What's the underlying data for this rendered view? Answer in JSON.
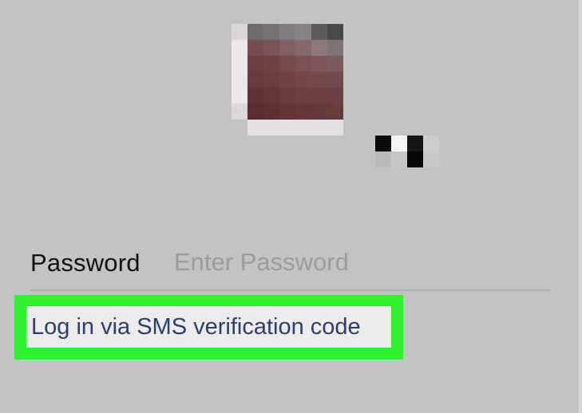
{
  "avatar": {
    "pixel_colors": [
      "#6f6a6b",
      "#767172",
      "#817c7d",
      "#878283",
      "#5e5b5c",
      "#4a4748",
      "#744e50",
      "#7a5558",
      "#806063",
      "#856a6c",
      "#8c7a7b",
      "#7c7475",
      "#6b3e40",
      "#6e4245",
      "#744a4d",
      "#7a5254",
      "#7c5658",
      "#7a5c5d",
      "#673a3c",
      "#6a3d3f",
      "#6f4245",
      "#73474a",
      "#74494b",
      "#714b4c",
      "#5f3234",
      "#633638",
      "#683b3d",
      "#6c3f41",
      "#6b3f41",
      "#6a4042",
      "#5a2d2f",
      "#5d3032",
      "#613436",
      "#653739",
      "#653a3b",
      "#663c3d"
    ]
  },
  "name_mark": {
    "pixel_colors": [
      "#0a0a0a",
      "#f4f4f4",
      "#151515",
      "#cdcdcd",
      "#b9b9b9",
      "#c7c7c7",
      "#050505",
      "#c9c9c9"
    ]
  },
  "login": {
    "password_label": "Password",
    "password_placeholder": "Enter Password",
    "sms_link_label": "Log in via SMS verification code"
  },
  "colors": {
    "background": "#c3c3c3",
    "highlight": "#2ff22f",
    "link_text": "#2a3f6e",
    "placeholder": "#9c9c9c"
  }
}
